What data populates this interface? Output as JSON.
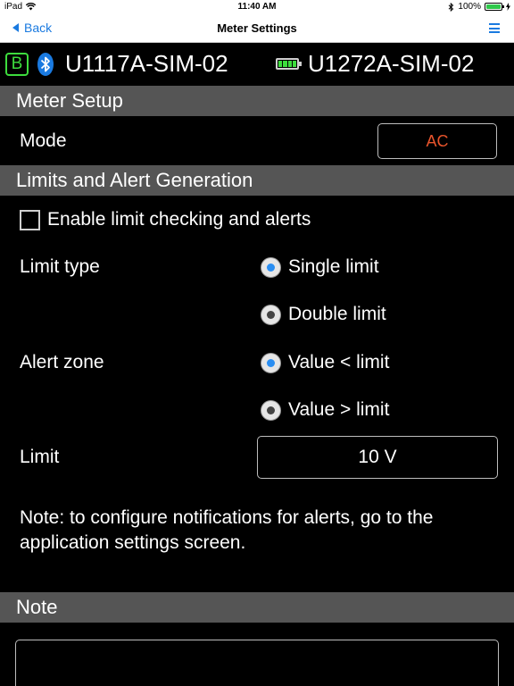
{
  "status_bar": {
    "device": "iPad",
    "time": "11:40 AM",
    "battery_percent": "100%",
    "battery_level": 1.0
  },
  "nav": {
    "back_label": "Back",
    "title": "Meter Settings"
  },
  "devices": {
    "badge": "B",
    "meter1": "U1117A-SIM-02",
    "meter2": "U1272A-SIM-02"
  },
  "meter_setup": {
    "header": "Meter Setup",
    "mode_label": "Mode",
    "mode_value": "AC"
  },
  "limits": {
    "header": "Limits and Alert Generation",
    "enable_label": "Enable limit checking and alerts",
    "enable_checked": false,
    "limit_type_label": "Limit type",
    "limit_type_options": [
      "Single limit",
      "Double limit"
    ],
    "limit_type_selected": 0,
    "alert_zone_label": "Alert zone",
    "alert_zone_options": [
      "Value < limit",
      "Value > limit"
    ],
    "alert_zone_selected": 0,
    "limit_label": "Limit",
    "limit_value": "10 V",
    "note": "Note: to configure notifications for alerts, go to the application settings screen."
  },
  "note_section": {
    "header": "Note",
    "value": ""
  },
  "colors": {
    "accent": "#1a7ae0",
    "mode_value": "#e8542c",
    "connected": "#3ddc3d",
    "section_header": "#555555"
  }
}
